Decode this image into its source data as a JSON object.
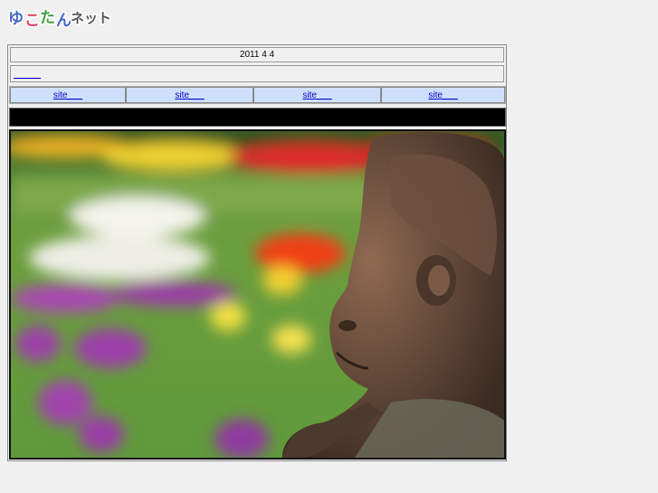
{
  "logo": {
    "text": "ゆこたんネット"
  },
  "header": {
    "date": "2011 4 4"
  },
  "top_link": {
    "label": "______"
  },
  "nav": {
    "items": [
      {
        "label": "site___"
      },
      {
        "label": "site___"
      },
      {
        "label": "site___"
      },
      {
        "label": "site___"
      }
    ]
  },
  "colors": {
    "nav_bg": "#cfe0ff",
    "link": "#0000cc",
    "bar": "#000000"
  }
}
